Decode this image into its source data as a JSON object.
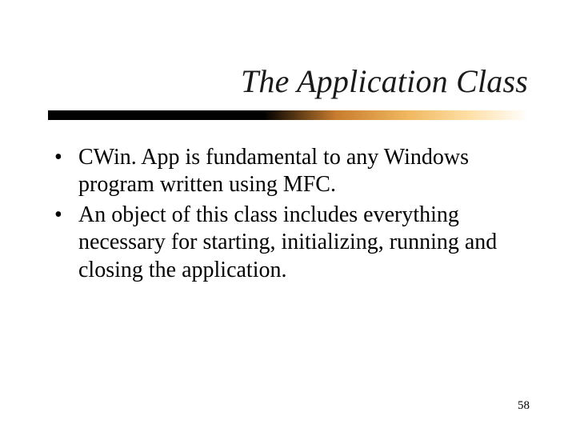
{
  "title": "The Application Class",
  "bullets": [
    "CWin. App is fundamental to any Windows program written using MFC.",
    "An object of this class includes everything necessary for starting, initializing, running and closing the application."
  ],
  "page_number": "58"
}
